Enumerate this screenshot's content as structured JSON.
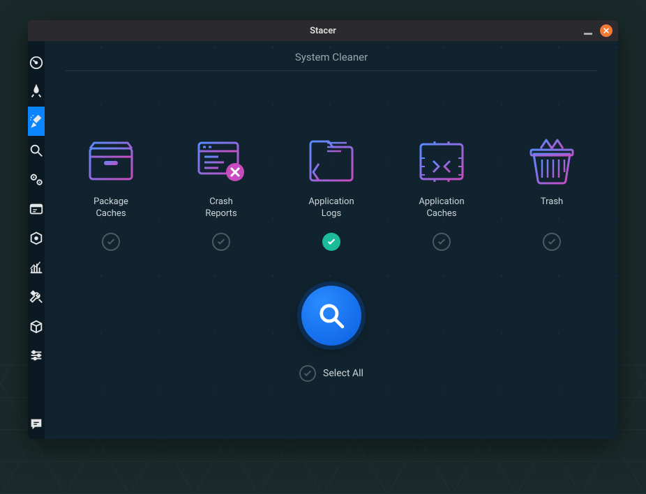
{
  "window": {
    "title": "Stacer"
  },
  "page": {
    "title": "System Cleaner"
  },
  "sidebar": {
    "items": [
      {
        "name": "dashboard"
      },
      {
        "name": "startup-apps"
      },
      {
        "name": "system-cleaner",
        "active": true
      },
      {
        "name": "search"
      },
      {
        "name": "services"
      },
      {
        "name": "processes"
      },
      {
        "name": "uninstaller"
      },
      {
        "name": "resources"
      },
      {
        "name": "settings-tools"
      },
      {
        "name": "apt-packages"
      },
      {
        "name": "settings-sliders"
      }
    ],
    "footer": {
      "name": "feedback"
    }
  },
  "cards": [
    {
      "label": "Package\nCaches",
      "checked": false,
      "name": "package-caches"
    },
    {
      "label": "Crash\nReports",
      "checked": false,
      "name": "crash-reports"
    },
    {
      "label": "Application\nLogs",
      "checked": true,
      "name": "application-logs"
    },
    {
      "label": "Application\nCaches",
      "checked": false,
      "name": "application-caches"
    },
    {
      "label": "Trash",
      "checked": false,
      "name": "trash"
    }
  ],
  "selectAll": {
    "label": "Select All",
    "checked": false
  },
  "colors": {
    "grad_start": "#5a8bff",
    "grad_end": "#c94bc0",
    "accent": "#1abc9c",
    "scan": "#0a6ef0"
  }
}
